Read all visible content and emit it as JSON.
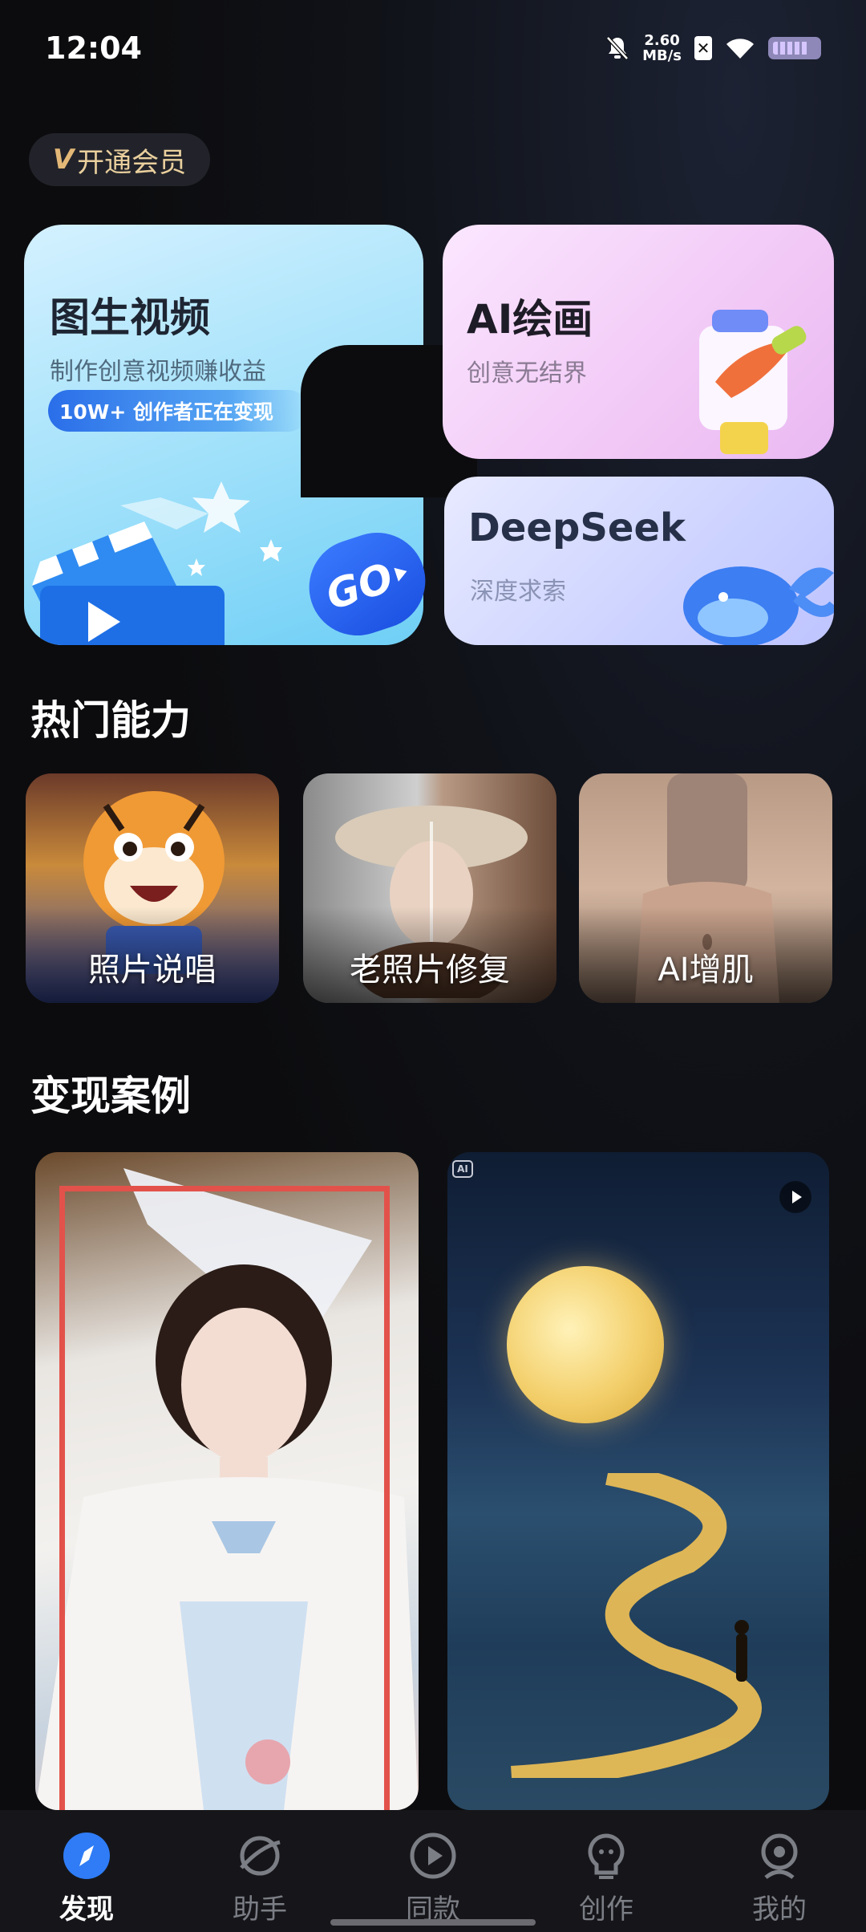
{
  "status_bar": {
    "time": "12:04",
    "speed_value": "2.60",
    "speed_unit": "MB/s",
    "icons": [
      "mute-bell-icon",
      "sim-x-icon",
      "wifi-icon",
      "battery-icon"
    ]
  },
  "vip": {
    "badge": "V",
    "label": "开通会员"
  },
  "features": {
    "video": {
      "title": "图生视频",
      "subtitle": "制作创意视频赚收益",
      "pill": "10W+ 创作者正在变现",
      "go": "GO"
    },
    "paint": {
      "title": "AI绘画",
      "subtitle": "创意无结界"
    },
    "deepseek": {
      "title": "DeepSeek",
      "subtitle": "深度求索"
    }
  },
  "hot": {
    "title": "热门能力",
    "items": [
      {
        "label": "照片说唱"
      },
      {
        "label": "老照片修复"
      },
      {
        "label": "AI增肌"
      }
    ]
  },
  "cases": {
    "title": "变现案例",
    "ai_badge": "AI"
  },
  "nav": {
    "items": [
      {
        "label": "发现",
        "icon": "compass-icon",
        "active": true
      },
      {
        "label": "助手",
        "icon": "assistant-icon",
        "active": false
      },
      {
        "label": "同款",
        "icon": "play-circle-icon",
        "active": false
      },
      {
        "label": "创作",
        "icon": "bulb-icon",
        "active": false
      },
      {
        "label": "我的",
        "icon": "profile-icon",
        "active": false
      }
    ]
  },
  "colors": {
    "accent": "#2f7cf6",
    "vip_gold": "#e3b877",
    "highlight": "#e2524b"
  }
}
